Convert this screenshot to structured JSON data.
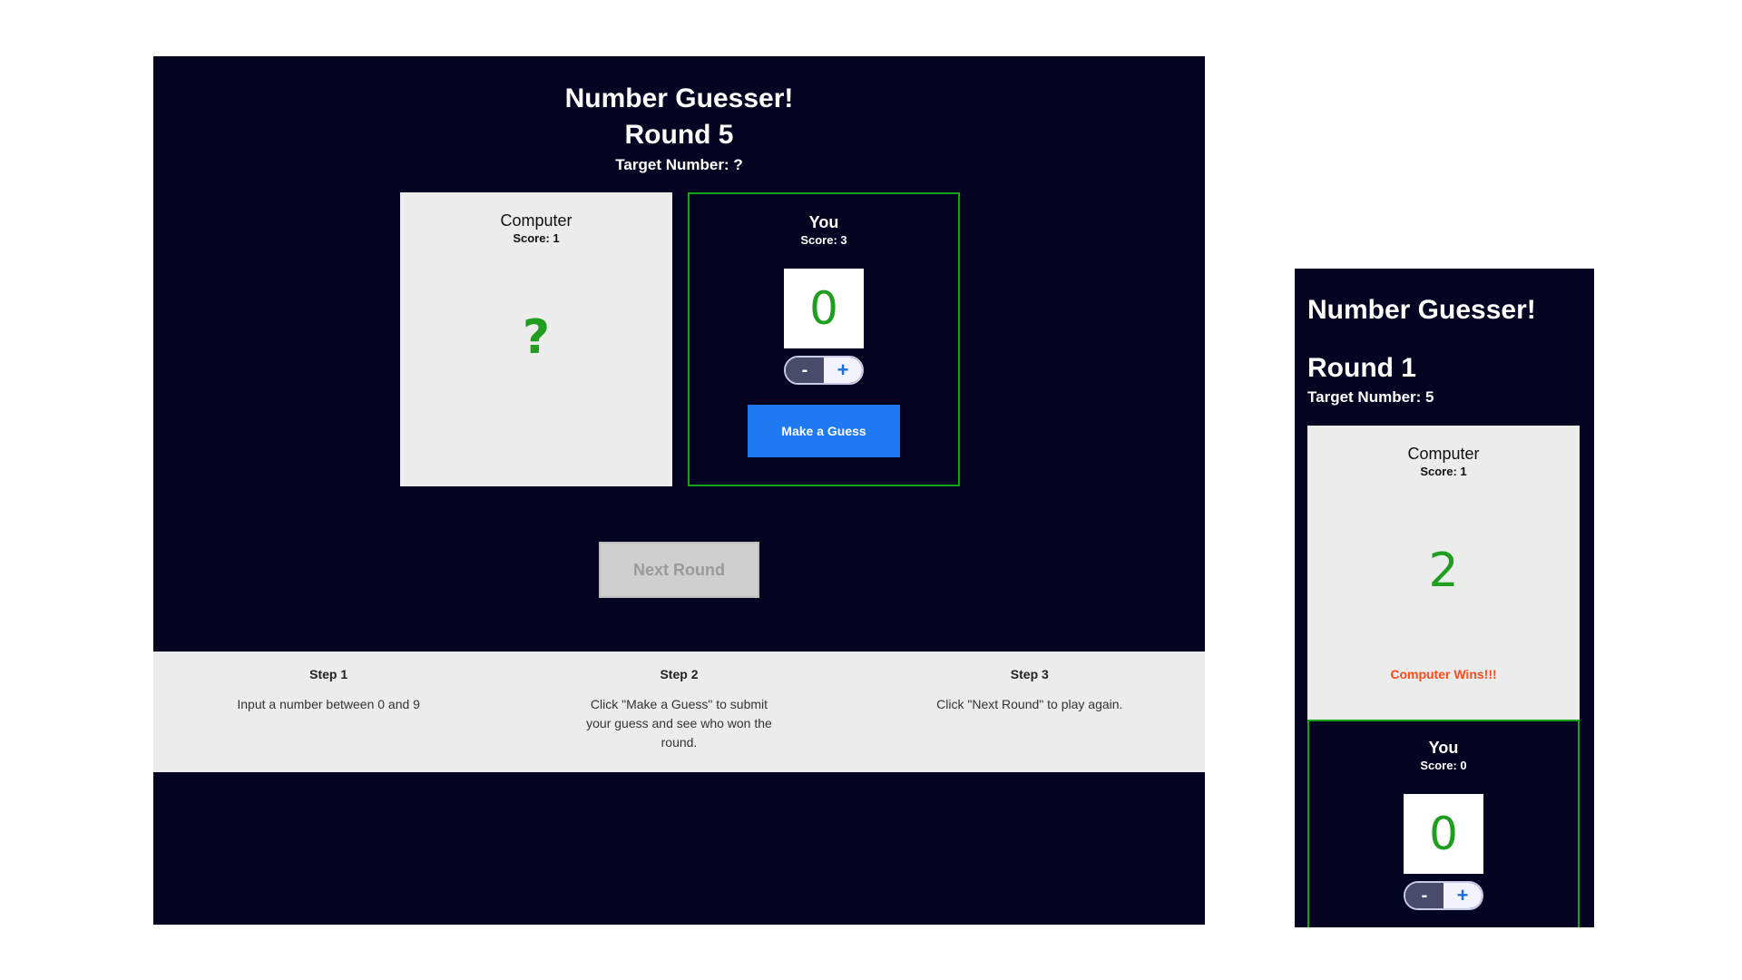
{
  "desktop": {
    "title": "Number Guesser!",
    "round": "Round 5",
    "target": "Target Number: ?",
    "computer": {
      "name": "Computer",
      "score": "Score: 1",
      "guess": "?"
    },
    "you": {
      "name": "You",
      "score": "Score: 3",
      "guess": "0"
    },
    "stepper": {
      "minus": "-",
      "plus": "+"
    },
    "guess_button": "Make a Guess",
    "next_button": "Next Round",
    "steps": [
      {
        "title": "Step 1",
        "text": "Input a number between 0 and 9"
      },
      {
        "title": "Step 2",
        "text": "Click \"Make a Guess\" to submit your guess and see who won the round."
      },
      {
        "title": "Step 3",
        "text": "Click \"Next Round\" to play again."
      }
    ]
  },
  "mobile": {
    "title": "Number Guesser!",
    "round": "Round 1",
    "target": "Target Number: 5",
    "computer": {
      "name": "Computer",
      "score": "Score: 1",
      "guess": "2",
      "result": "Computer Wins!!!"
    },
    "you": {
      "name": "You",
      "score": "Score: 0",
      "guess": "0"
    },
    "stepper": {
      "minus": "-",
      "plus": "+"
    }
  },
  "colors": {
    "background": "#050322",
    "panel": "#ececec",
    "accent_green": "#1f9e1f",
    "border_green": "#14a314",
    "button_blue": "#1f7af2",
    "result_orange": "#ff4a1a"
  }
}
